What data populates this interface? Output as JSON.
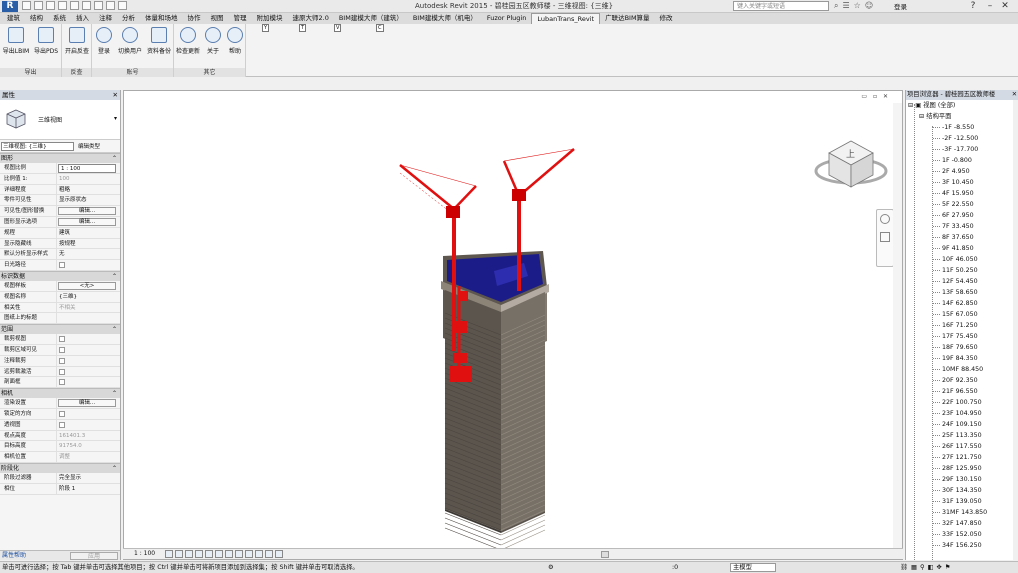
{
  "titlebar": {
    "app_badge": "R",
    "title": "Autodesk Revit 2015 -   碧桂园五区教师楼 - 三维视图: {三维}",
    "search_placeholder": "键入关键字或短语",
    "login": "登录",
    "help": "?"
  },
  "tabs": [
    "建筑",
    "结构",
    "系统",
    "插入",
    "注释",
    "分析",
    "体量和场地",
    "协作",
    "视图",
    "管理",
    "附加模块",
    "速原大师2.0",
    "BIM建模大师（建筑）",
    "BIM建模大师（机电）",
    "Fuzor Plugin",
    "LubanTrans_Revit",
    "广联达BIM算量",
    "修改"
  ],
  "active_tab": "LubanTrans_Revit",
  "keytips": [
    "Y",
    "T",
    "V",
    "C"
  ],
  "ribbon": {
    "panels": [
      {
        "label": "导出",
        "buttons": [
          "导出LBIM",
          "导出PDS"
        ]
      },
      {
        "label": "反查",
        "buttons": [
          "开启反查"
        ]
      },
      {
        "label": "账号",
        "buttons": [
          "登录",
          "切换用户",
          "资料备份"
        ]
      },
      {
        "label": "其它",
        "buttons": [
          "检查更新",
          "关于",
          "帮助"
        ]
      }
    ]
  },
  "properties": {
    "header": "属性",
    "type_name": "三维视图",
    "filter_value": "三维视图: {三维}",
    "edit_type": "编辑类型",
    "sections": [
      {
        "name": "图形",
        "rows": [
          {
            "k": "视图比例",
            "v": "1 : 100",
            "t": "input"
          },
          {
            "k": "比例值 1:",
            "v": "100",
            "t": "grey"
          },
          {
            "k": "详细程度",
            "v": "粗略",
            "t": "text"
          },
          {
            "k": "零件可见性",
            "v": "显示原状态",
            "t": "text"
          },
          {
            "k": "可见性/图形替换",
            "v": "编辑...",
            "t": "button"
          },
          {
            "k": "图形显示选项",
            "v": "编辑...",
            "t": "button"
          },
          {
            "k": "规程",
            "v": "建筑",
            "t": "text"
          },
          {
            "k": "显示隐藏线",
            "v": "按规程",
            "t": "text"
          },
          {
            "k": "默认分析显示样式",
            "v": "无",
            "t": "text"
          },
          {
            "k": "日光路径",
            "v": "",
            "t": "check"
          }
        ]
      },
      {
        "name": "标识数据",
        "rows": [
          {
            "k": "视图样板",
            "v": "<无>",
            "t": "button"
          },
          {
            "k": "视图名称",
            "v": "{三维}",
            "t": "text"
          },
          {
            "k": "相关性",
            "v": "不相关",
            "t": "grey"
          },
          {
            "k": "图纸上的标题",
            "v": "",
            "t": "text"
          }
        ]
      },
      {
        "name": "范围",
        "rows": [
          {
            "k": "裁剪视图",
            "v": "",
            "t": "check"
          },
          {
            "k": "裁剪区域可见",
            "v": "",
            "t": "check"
          },
          {
            "k": "注释裁剪",
            "v": "",
            "t": "check"
          },
          {
            "k": "远剪裁激活",
            "v": "",
            "t": "check"
          },
          {
            "k": "剖面框",
            "v": "",
            "t": "check"
          }
        ]
      },
      {
        "name": "相机",
        "rows": [
          {
            "k": "渲染设置",
            "v": "编辑...",
            "t": "button"
          },
          {
            "k": "锁定的方向",
            "v": "",
            "t": "check"
          },
          {
            "k": "透视图",
            "v": "",
            "t": "check"
          },
          {
            "k": "视点高度",
            "v": "161401.3",
            "t": "grey"
          },
          {
            "k": "目标高度",
            "v": "91754.0",
            "t": "grey"
          },
          {
            "k": "相机位置",
            "v": "调整",
            "t": "grey"
          }
        ]
      },
      {
        "name": "阶段化",
        "rows": [
          {
            "k": "阶段过滤器",
            "v": "完全显示",
            "t": "text"
          },
          {
            "k": "相位",
            "v": "阶段 1",
            "t": "text"
          }
        ]
      }
    ],
    "help_link": "属性帮助",
    "apply": "应用"
  },
  "viewport": {
    "view_controls": "▭ ▫ ✕",
    "viewcube_label": "上"
  },
  "viewbar": {
    "scale": "1 : 100"
  },
  "browser": {
    "header": "项目浏览器 - 碧桂园五区教师楼",
    "root": "视图 (全部)",
    "group": "结构平面",
    "levels": [
      "-1F -8.550",
      "-2F -12.500",
      "-3F -17.700",
      "1F -0.800",
      "2F 4.950",
      "3F 10.450",
      "4F 15.950",
      "5F 22.550",
      "6F 27.950",
      "7F 33.450",
      "8F 37.650",
      "9F 41.850",
      "10F 46.050",
      "11F 50.250",
      "12F 54.450",
      "13F 58.650",
      "14F 62.850",
      "15F 67.050",
      "16F 71.250",
      "17F 75.450",
      "18F 79.650",
      "19F 84.350",
      "10MF 88.450",
      "20F 92.350",
      "21F 96.550",
      "22F 100.750",
      "23F 104.950",
      "24F 109.150",
      "25F 113.350",
      "26F 117.550",
      "27F 121.750",
      "28F 125.950",
      "29F 130.150",
      "30F 134.350",
      "31F 139.050",
      "31MF 143.850",
      "32F 147.850",
      "33F 152.050",
      "34F 156.250"
    ]
  },
  "statusbar": {
    "message": "单击可进行选择；按 Tab 键并单击可选择其他项目；按 Ctrl 键并单击可将新项目添加到选择集；按 Shift 键并单击可取消选择。",
    "zero": ":0",
    "model": "主模型"
  },
  "colors": {
    "crane": "#e01010",
    "roof": "#1a1a8e",
    "tower": "#6b6159"
  }
}
